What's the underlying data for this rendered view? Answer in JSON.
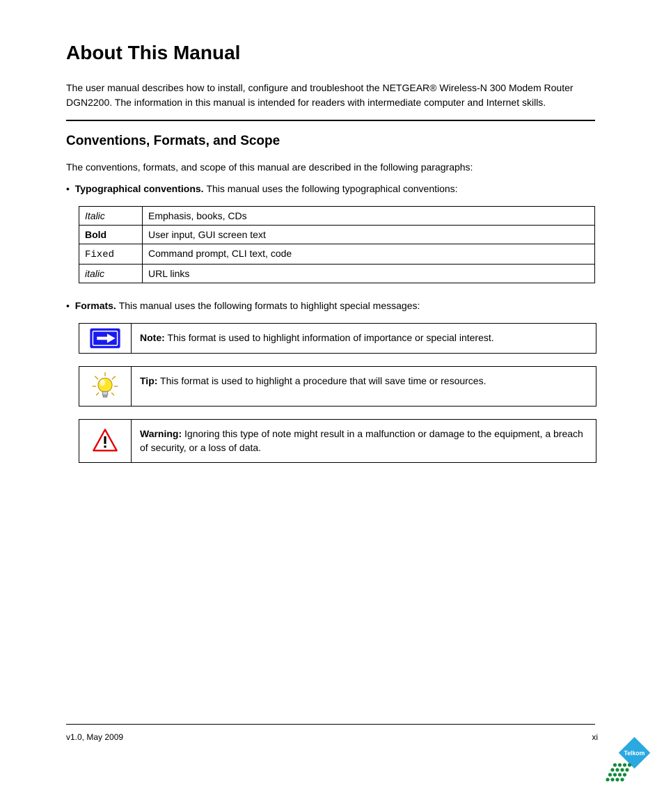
{
  "title": "About This Manual",
  "intro_paragraphs": [
    "The user manual describes how to install, configure and troubleshoot the NETGEAR® Wireless-N 300 Modem Router DGN2200. The information in this manual is intended for readers with intermediate computer and Internet skills."
  ],
  "conventions_section": {
    "heading": "Conventions, Formats, and Scope",
    "lead_typo": "The conventions, formats, and scope of this manual are described in the following paragraphs:",
    "typo_label": "Typographical conventions. ",
    "typo_desc": "This manual uses the following typographical conventions:",
    "table": [
      {
        "style": "Italic",
        "desc": "Emphasis, books, CDs"
      },
      {
        "style": "Bold",
        "desc": "User input, GUI screen text"
      },
      {
        "style": "Fixed",
        "desc": "Command prompt, CLI text, code"
      },
      {
        "style_plain": "italic",
        "desc": "URL links"
      }
    ],
    "formats_label": "Formats. ",
    "formats_desc": "This manual uses the following formats to highlight special messages:",
    "note": {
      "label": "Note:",
      "text": " This format is used to highlight information of importance or special interest."
    },
    "tip": {
      "label": "Tip:",
      "text": " This format is used to highlight a procedure that will save time or resources."
    },
    "warning": {
      "label": "Warning:",
      "text": " Ignoring this type of note might result in a malfunction or damage to the equipment, a breach of security, or a loss of data."
    }
  },
  "footer": {
    "left": "v1.0, May 2009",
    "right": "xi"
  }
}
